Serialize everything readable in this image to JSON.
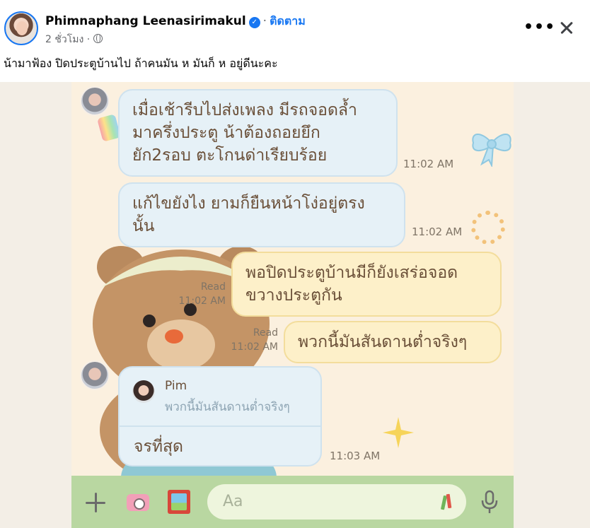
{
  "post": {
    "author": "Phimnaphang Leenasirimakul",
    "follow_label": "ติดตาม",
    "time": "2 ชั่วโมง",
    "caption": "น้ามาฟ้อง ปิดประตูบ้านไป ถ้าคนมัน ห มันก็ ห อยู่ดีนะคะ",
    "icons": [
      "verified-icon",
      "globe-icon",
      "more-icon",
      "close-icon"
    ]
  },
  "chat": {
    "messages": [
      {
        "side": "left",
        "text": "เมื่อเช้ารีบไปส่งเพลง มีรถจอดล้ำ\nมาครึ่งประตู น้าต้องถอยยึก\nยัก2รอบ ตะโกนด่าเรียบร้อย",
        "time": "11:02 AM"
      },
      {
        "side": "left",
        "text": "แก้ไขยังไง ยามก็ยืนหน้าโง่อยู่ตรง\nนั้น",
        "time": "11:02 AM"
      },
      {
        "side": "right",
        "text": "พอปิดประตูบ้านมีก็ยังเสร่อจอด\nขวางประตูกัน",
        "read": "Read",
        "time": "11:02 AM"
      },
      {
        "side": "right",
        "text": "พวกนี้มันสันดานต่ำจริงๆ",
        "read": "Read",
        "time": "11:02 AM"
      }
    ],
    "reply": {
      "quoted_name": "Pim",
      "quoted_text": "พวกนี้มันสันดานต่ำจริงๆ",
      "text": "จรที่สุด",
      "time": "11:03 AM"
    },
    "input": {
      "placeholder": "Aa"
    },
    "colors": {
      "left_bubble": "#e6f1f7",
      "right_bubble": "#fdf0c9",
      "input_bar": "#b9d7a1"
    }
  }
}
